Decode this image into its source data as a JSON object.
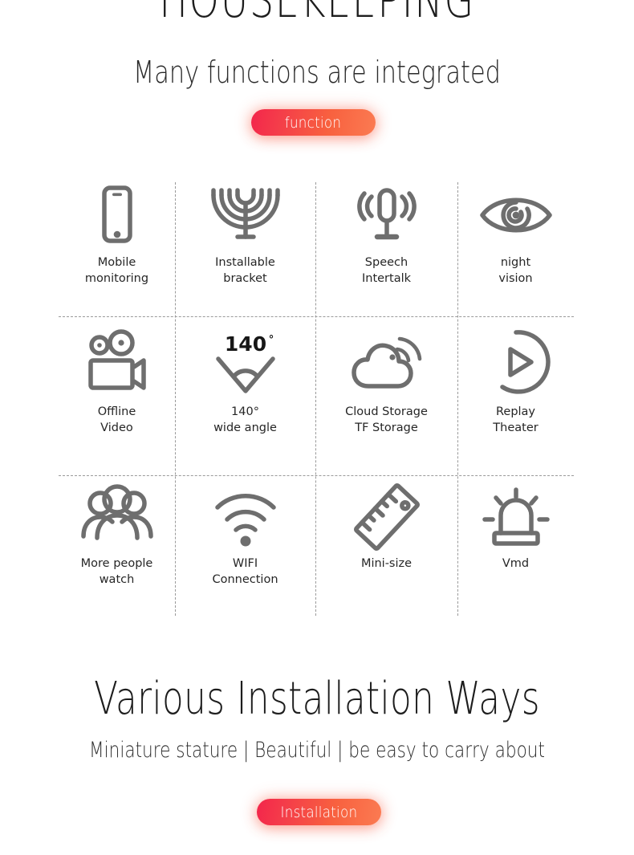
{
  "header": {
    "title": "HOUSEKEEPING",
    "subtitle": "Many functions are integrated",
    "pill_label": "function"
  },
  "footer": {
    "title": "Various Installation Ways",
    "subtitle": "Miniature stature | Beautiful | be easy to carry about",
    "pill_label": "Installation"
  },
  "colors": {
    "pill_gradient_start": "#f3264b",
    "pill_gradient_end": "#fb7b52",
    "icon_gray": "#6e6e6e",
    "text_dark": "#262626",
    "divider_gray": "#9a9a9a",
    "background": "#ffffff"
  },
  "features": {
    "rows": [
      {
        "cells": [
          {
            "label": "Mobile\nmonitoring",
            "icon": "smartphone-icon"
          },
          {
            "label": "Installable\nbracket",
            "icon": "bracket-icon"
          },
          {
            "label": "Speech\nIntertalk",
            "icon": "microphone-icon"
          },
          {
            "label": "night\nvision",
            "icon": "eye-icon"
          }
        ]
      },
      {
        "cells": [
          {
            "label": "Offline\nVideo",
            "icon": "video-camera-icon"
          },
          {
            "label": "140°\nwide angle",
            "icon": "wide-angle-icon",
            "icon_text": "140",
            "icon_text_sup": "°"
          },
          {
            "label": "Cloud Storage\nTF Storage",
            "icon": "cloud-wifi-icon"
          },
          {
            "label": "Replay\nTheater",
            "icon": "play-circle-icon"
          }
        ]
      },
      {
        "cells": [
          {
            "label": "More people\nwatch",
            "icon": "people-group-icon"
          },
          {
            "label": "WIFI\nConnection",
            "icon": "wifi-icon"
          },
          {
            "label": "Mini-size",
            "icon": "ruler-icon"
          },
          {
            "label": "Vmd",
            "icon": "siren-icon"
          }
        ]
      }
    ]
  }
}
